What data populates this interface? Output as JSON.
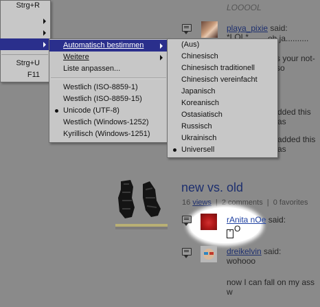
{
  "left_menu": {
    "items": [
      {
        "shortcut": "Strg+R",
        "has_submenu": false
      },
      {
        "shortcut": "",
        "has_submenu": true
      },
      {
        "shortcut": "",
        "has_submenu": true
      },
      {
        "shortcut": "",
        "has_submenu": true,
        "highlighted": true
      },
      {
        "shortcut": "Strg+U",
        "has_submenu": false
      },
      {
        "shortcut": "F11",
        "has_submenu": false
      }
    ]
  },
  "encoding_menu": {
    "items": [
      {
        "label": "Automatisch bestimmen",
        "has_submenu": true,
        "highlighted": true
      },
      {
        "label": "Weitere",
        "has_submenu": true
      },
      {
        "label": "Liste anpassen..."
      }
    ],
    "encodings": [
      {
        "label": "Westlich (ISO-8859-1)",
        "selected": false
      },
      {
        "label": "Westlich (ISO-8859-15)",
        "selected": false
      },
      {
        "label": "Unicode (UTF-8)",
        "selected": true
      },
      {
        "label": "Westlich (Windows-1252)",
        "selected": false
      },
      {
        "label": "Kyrillisch (Windows-1251)",
        "selected": false
      }
    ]
  },
  "autodetect_menu": {
    "items": [
      {
        "label": "(Aus)",
        "selected": false
      },
      {
        "label": "Chinesisch",
        "selected": false
      },
      {
        "label": "Chinesisch traditionell",
        "selected": false
      },
      {
        "label": "Chinesisch vereinfacht",
        "selected": false
      },
      {
        "label": "Japanisch",
        "selected": false
      },
      {
        "label": "Koreanisch",
        "selected": false
      },
      {
        "label": "Ostasiatisch",
        "selected": false
      },
      {
        "label": "Russisch",
        "selected": false
      },
      {
        "label": "Ukrainisch",
        "selected": false
      },
      {
        "label": "Universell",
        "selected": true
      }
    ]
  },
  "page": {
    "top_comment_text": "LOOOOL",
    "comment1": {
      "user": "playa_pixie",
      "said": "said:",
      "line1": "*LOL*",
      "line2": "...oh ja.........."
    },
    "partial_lines": [
      "s your not-so",
      "dded this as",
      "added this as"
    ],
    "post": {
      "title": "new vs. old",
      "views_count": "16",
      "views_label": "views",
      "comments": "2 comments",
      "favorites": "0 favorites",
      "sep": "|"
    },
    "comment2": {
      "user": "rAnita nOe",
      "said": "said:",
      "text": "O"
    },
    "comment3": {
      "user": "dreikelvin",
      "said": "said:",
      "text": "wohooo",
      "text2": "now I can fall on my ass w"
    }
  },
  "colors": {
    "highlight": "#2a2f8c",
    "link": "#1d2f6e",
    "menu_bg": "#c7c7c7",
    "page_bg": "#8a8a8a"
  }
}
